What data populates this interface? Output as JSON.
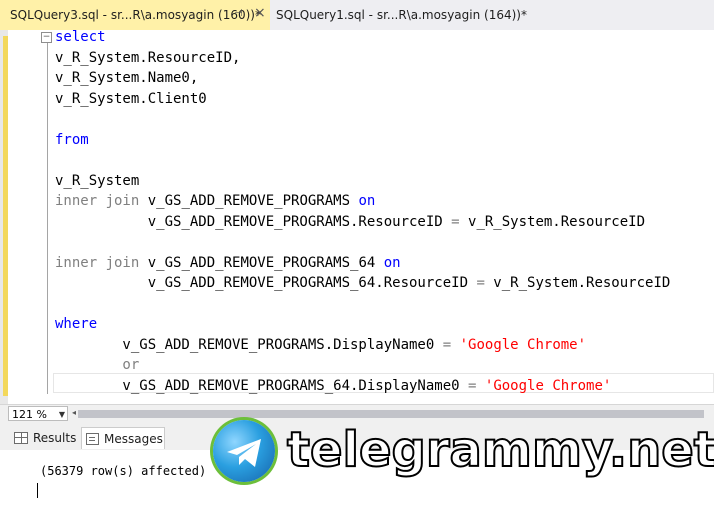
{
  "tabs": [
    {
      "title": "SQLQuery3.sql - sr...R\\a.mosyagin (160))*",
      "active": true
    },
    {
      "title": "SQLQuery1.sql - sr...R\\a.mosyagin (164))*",
      "active": false
    }
  ],
  "editor": {
    "lines": [
      [
        {
          "t": "select",
          "c": "kw"
        }
      ],
      [
        {
          "t": "v_R_System.ResourceID,",
          "c": ""
        }
      ],
      [
        {
          "t": "v_R_System.Name0,",
          "c": ""
        }
      ],
      [
        {
          "t": "v_R_System.Client0",
          "c": ""
        }
      ],
      [],
      [
        {
          "t": "from",
          "c": "kw"
        }
      ],
      [],
      [
        {
          "t": "v_R_System",
          "c": ""
        }
      ],
      [
        {
          "t": "inner join",
          "c": "gr"
        },
        {
          "t": " v_GS_ADD_REMOVE_PROGRAMS ",
          "c": ""
        },
        {
          "t": "on",
          "c": "kw"
        }
      ],
      [
        {
          "t": "           v_GS_ADD_REMOVE_PROGRAMS.ResourceID ",
          "c": ""
        },
        {
          "t": "=",
          "c": "gr"
        },
        {
          "t": " v_R_System.ResourceID",
          "c": ""
        }
      ],
      [],
      [
        {
          "t": "inner join",
          "c": "gr"
        },
        {
          "t": " v_GS_ADD_REMOVE_PROGRAMS_64 ",
          "c": ""
        },
        {
          "t": "on",
          "c": "kw"
        }
      ],
      [
        {
          "t": "           v_GS_ADD_REMOVE_PROGRAMS_64.ResourceID ",
          "c": ""
        },
        {
          "t": "=",
          "c": "gr"
        },
        {
          "t": " v_R_System.ResourceID",
          "c": ""
        }
      ],
      [],
      [
        {
          "t": "where",
          "c": "kw"
        }
      ],
      [
        {
          "t": "        v_GS_ADD_REMOVE_PROGRAMS.DisplayName0 ",
          "c": ""
        },
        {
          "t": "=",
          "c": "gr"
        },
        {
          "t": " ",
          "c": ""
        },
        {
          "t": "'Google Chrome'",
          "c": "str"
        }
      ],
      [
        {
          "t": "        or",
          "c": "gr"
        }
      ],
      [
        {
          "t": "        v_GS_ADD_REMOVE_PROGRAMS_64.DisplayName0 ",
          "c": ""
        },
        {
          "t": "=",
          "c": "gr"
        },
        {
          "t": " ",
          "c": ""
        },
        {
          "t": "'Google Chrome'",
          "c": "str"
        }
      ]
    ]
  },
  "zoom": {
    "value": "121 %"
  },
  "result_tabs": {
    "results": "Results",
    "messages": "Messages"
  },
  "messages": {
    "text": "(56379 row(s) affected)"
  },
  "watermark": {
    "text": "telegrammy.net"
  },
  "colors": {
    "keyword": "#0000ff",
    "operator": "#808080",
    "string": "#ff0000",
    "active_tab": "#fff1a8"
  }
}
